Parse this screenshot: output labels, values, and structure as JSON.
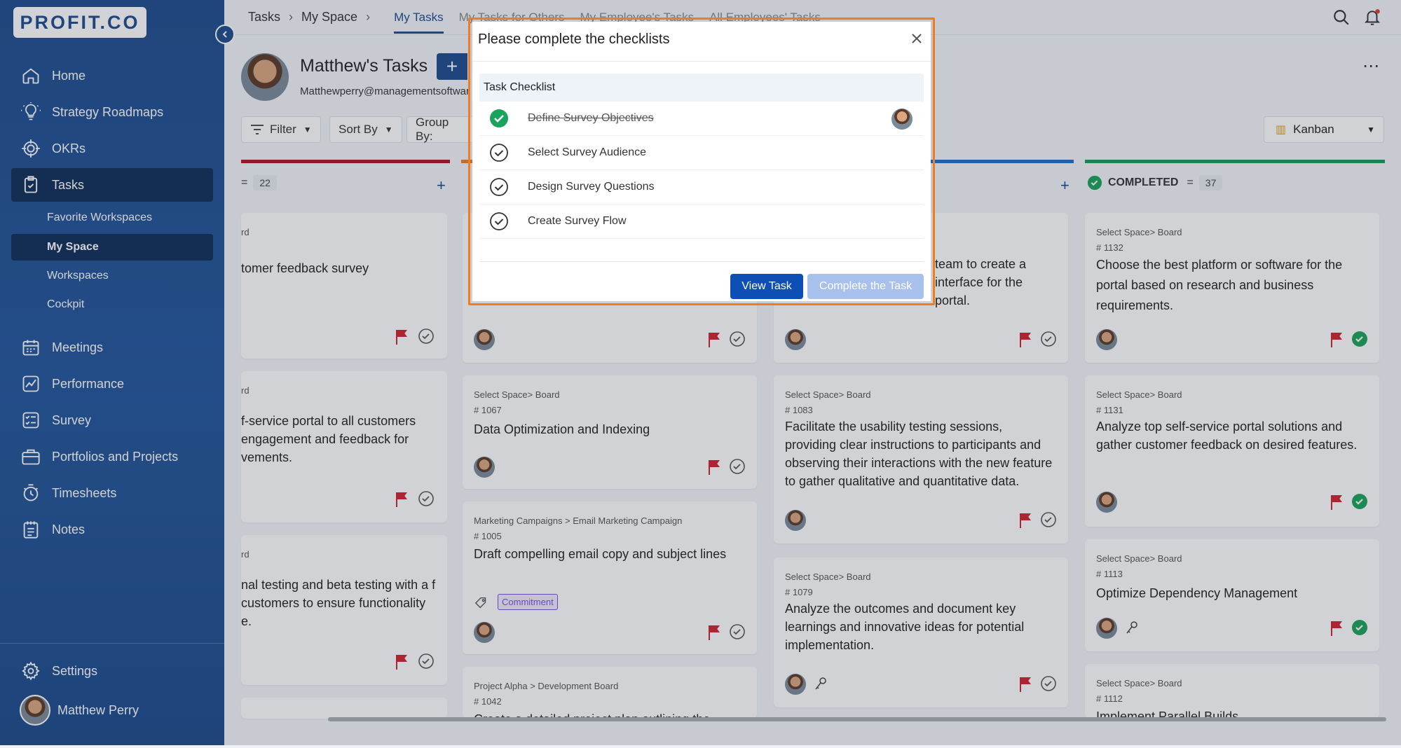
{
  "brand": {
    "logo_text": "PROFIT.CO"
  },
  "sidebar": {
    "items": [
      {
        "label": "Home",
        "icon": "home-icon"
      },
      {
        "label": "Strategy Roadmaps",
        "icon": "lightbulb-icon"
      },
      {
        "label": "OKRs",
        "icon": "target-icon"
      },
      {
        "label": "Tasks",
        "icon": "clipboard-check-icon"
      },
      {
        "label": "Meetings",
        "icon": "calendar-icon"
      },
      {
        "label": "Performance",
        "icon": "chart-line-icon"
      },
      {
        "label": "Survey",
        "icon": "list-check-icon"
      },
      {
        "label": "Portfolios and Projects",
        "icon": "briefcase-icon"
      },
      {
        "label": "Timesheets",
        "icon": "stopwatch-icon"
      },
      {
        "label": "Notes",
        "icon": "notes-icon"
      }
    ],
    "sub_items": [
      "Favorite Workspaces",
      "My Space",
      "Workspaces",
      "Cockpit"
    ],
    "settings_label": "Settings",
    "user_name": "Matthew Perry"
  },
  "topbar": {
    "breadcrumb": [
      "Tasks",
      "My Space"
    ],
    "tabs": [
      "My Tasks",
      "My Tasks for Others",
      "My Employee's Tasks",
      "All Employees' Tasks"
    ]
  },
  "header": {
    "title": "Matthew's Tasks",
    "add_symbol": "+",
    "email": "Matthewperry@managementsoftware",
    "more_symbol": "⋯"
  },
  "toolbar": {
    "filter_label": "Filter",
    "sort_label": "Sort By",
    "group_label": "Group By:",
    "view_label": "Kanban"
  },
  "columns": [
    {
      "count": "22"
    },
    {
      "label": "COMPLETED",
      "count": "37"
    }
  ],
  "cards": {
    "c1": {
      "meta": "rd",
      "title": "tomer feedback survey"
    },
    "c2": {
      "meta": "rd",
      "title": "f-service portal to all customers engagement and feedback for vements."
    },
    "c3": {
      "meta": "rd",
      "title": "nal testing and beta testing with a f customers to ensure functionality e."
    },
    "c4": {
      "meta": "Select Space> Board",
      "id": "# 1067",
      "title": "Data Optimization and Indexing"
    },
    "c5": {
      "meta": "Marketing Campaigns > Email Marketing Campaign",
      "id": "# 1005",
      "title": "Draft compelling email copy and subject lines",
      "tag": "Commitment"
    },
    "c6": {
      "meta": "Project Alpha > Development Board",
      "id": "# 1042",
      "title": "Create a detailed project plan outlining the"
    },
    "c7": {
      "title": "team to create a interface for the portal."
    },
    "c8": {
      "meta": "Select Space> Board",
      "id": "# 1083",
      "title": "Facilitate the usability testing sessions, providing clear instructions to participants and observing their interactions with the new feature to gather qualitative and quantitative data."
    },
    "c9": {
      "meta": "Select Space> Board",
      "id": "# 1079",
      "title": "Analyze the outcomes and document key learnings and innovative ideas for potential implementation."
    },
    "c10": {
      "meta": "Select Space> Board",
      "id": "# 1132",
      "title": "Choose the best platform or software for the portal based on research and business requirements."
    },
    "c11": {
      "meta": "Select Space> Board",
      "id": "# 1131",
      "title": "Analyze top self-service portal solutions and gather customer feedback on desired features."
    },
    "c12": {
      "meta": "Select Space> Board",
      "id": "# 1113",
      "title": "Optimize Dependency Management"
    },
    "c13": {
      "meta": "Select Space> Board",
      "id": "# 1112",
      "title": "Implement Parallel Builds"
    }
  },
  "modal": {
    "title": "Please complete the checklists",
    "section_label": "Task Checklist",
    "items": [
      {
        "label": "Define Survey Objectives",
        "done": true
      },
      {
        "label": "Select Survey Audience",
        "done": false
      },
      {
        "label": "Design Survey Questions",
        "done": false
      },
      {
        "label": "Create Survey Flow",
        "done": false
      }
    ],
    "view_button": "View Task",
    "complete_button": "Complete the Task"
  },
  "colors": {
    "accent": "#1d4b8d",
    "highlight_border": "#f07c22",
    "done_green": "#1aa35a",
    "flag_red": "#d32030"
  }
}
